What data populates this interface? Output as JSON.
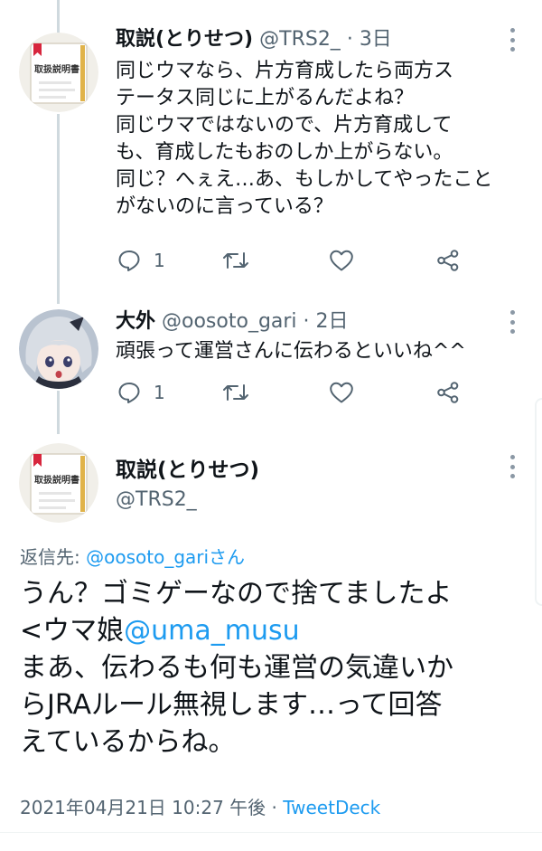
{
  "tweets": [
    {
      "author_name": "取説(とりせつ)",
      "handle": "@TRS2_",
      "separator": "·",
      "time": "3日",
      "avatar_text": "取扱説明書",
      "lines": [
        "同じウマなら、片方育成したら両方ス",
        "テータス同じに上がるんだよね？",
        "同じウマではないので、片方育成して",
        "も、育成したもおのしか上がらない。",
        "同じ？へぇえ…あ、もしかしてやったこと",
        "がないのに言っている？"
      ],
      "reply_count": "1"
    },
    {
      "author_name": "大外",
      "handle": "@oosoto_gari",
      "separator": "·",
      "time": "2日",
      "lines": [
        "頑張って運営さんに伝わるといいね^^"
      ],
      "reply_count": "1"
    }
  ],
  "main_tweet": {
    "author_name": "取説(とりせつ)",
    "handle": "@TRS2_",
    "avatar_text": "取扱説明書",
    "reply_label": "返信先: ",
    "reply_target": "@oosoto_gariさん",
    "text_1": "うん？ゴミゲーなので捨てましたよ",
    "text_2_prefix": "<ウマ娘",
    "mention": "@uma_musu",
    "text_3": "まあ、伝わるも何も運営の気違いか",
    "text_4": "らJRAルール無視します…って回答",
    "text_5": "えているからね。",
    "timestamp": "2021年04月21日 10:27 午後",
    "separator": " · ",
    "source": "TweetDeck"
  },
  "icons": [
    "reply-icon",
    "retweet-icon",
    "like-icon",
    "share-icon",
    "more-icon"
  ],
  "colors": {
    "link": "#1d9bf0",
    "secondary": "#536471",
    "thread_line": "#cfd9de"
  }
}
